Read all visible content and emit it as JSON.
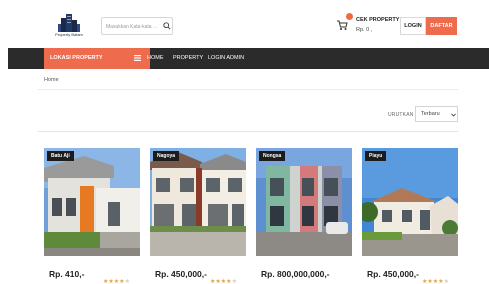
{
  "header": {
    "logo_text": "Property Batam",
    "search_placeholder": "Masukkan Kata-kata ...",
    "cek_property_label": "CEK PROPERTY :",
    "cek_property_value": "Rp. 0 ,",
    "login_label": "LOGIN",
    "daftar_label": "DAFTAR"
  },
  "nav": {
    "lokasi_label": "LOKASI PROPERTY",
    "items": [
      "HOME",
      "PROPERTY",
      "LOGIN ADMIN"
    ]
  },
  "breadcrumb": {
    "home": "Home"
  },
  "sort": {
    "label": "URUTKAN :",
    "selected": "Terbaru"
  },
  "listings": [
    {
      "location": "Batu Aji",
      "price": "Rp. 410,-",
      "rating": 4,
      "rating_max": 5
    },
    {
      "location": "Nagoya",
      "price": "Rp. 450,000,-",
      "rating": 4,
      "rating_max": 5
    },
    {
      "location": "Nongsa",
      "price": "Rp. 800,000,000,-",
      "rating": 4,
      "rating_max": 5
    },
    {
      "location": "Piayu",
      "price": "Rp. 450,000,-",
      "rating": 4,
      "rating_max": 5
    }
  ],
  "colors": {
    "accent": "#ef6b4e",
    "nav_bg": "#2b2b2b",
    "star": "#e4a23c"
  }
}
